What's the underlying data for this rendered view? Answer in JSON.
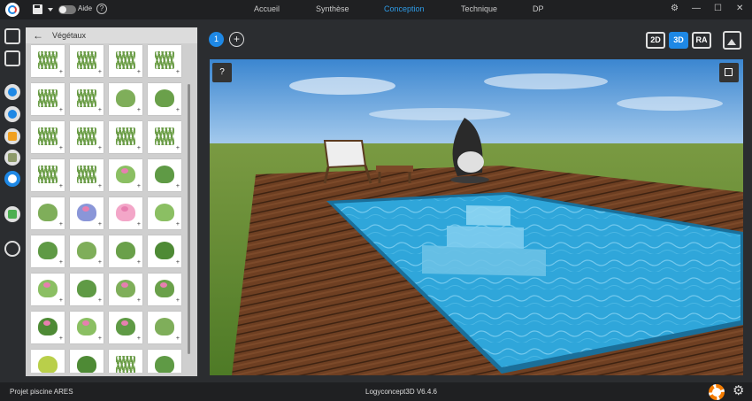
{
  "topbar": {
    "aide_label": "Aide",
    "help_label": "?",
    "tabs": [
      {
        "label": "Accueil",
        "active": false
      },
      {
        "label": "Synthèse",
        "active": false
      },
      {
        "label": "Conception",
        "active": true
      },
      {
        "label": "Technique",
        "active": false
      },
      {
        "label": "DP",
        "active": false
      }
    ],
    "window_buttons": {
      "settings": "⚙",
      "minimize": "—",
      "maximize": "☐",
      "close": "✕"
    }
  },
  "colors": {
    "accent": "#1e88e5",
    "active_tab": "#2e9be6",
    "topbar_bg": "#1f2022"
  },
  "panel": {
    "back_icon": "arrow-left-icon",
    "title": "Végétaux",
    "items": [
      {
        "icon": "ornamental-grass-red-icon"
      },
      {
        "icon": "ornamental-grass-icon"
      },
      {
        "icon": "ornamental-grass-icon"
      },
      {
        "icon": "ornamental-grass-icon"
      },
      {
        "icon": "grass-tuft-icon"
      },
      {
        "icon": "grass-tuft-icon"
      },
      {
        "icon": "small-shrub-icon"
      },
      {
        "icon": "fern-icon"
      },
      {
        "icon": "tall-grass-icon"
      },
      {
        "icon": "reed-grass-icon"
      },
      {
        "icon": "small-grass-icon"
      },
      {
        "icon": "grass-tuft-icon"
      },
      {
        "icon": "grass-clump-icon"
      },
      {
        "icon": "fountain-grass-icon"
      },
      {
        "icon": "pink-flower-icon"
      },
      {
        "icon": "shrub-icon"
      },
      {
        "icon": "planter-box-icon"
      },
      {
        "icon": "blue-flowers-icon"
      },
      {
        "icon": "lotus-icon"
      },
      {
        "icon": "leafy-shrub-icon"
      },
      {
        "icon": "leafy-shrub-icon"
      },
      {
        "icon": "leafy-shrub-icon"
      },
      {
        "icon": "leafy-shrub-icon"
      },
      {
        "icon": "leafy-shrub-icon"
      },
      {
        "icon": "lupin-icon"
      },
      {
        "icon": "palm-plant-icon"
      },
      {
        "icon": "flowering-bush-icon"
      },
      {
        "icon": "flowering-bush-icon"
      },
      {
        "icon": "rose-bush-icon"
      },
      {
        "icon": "rose-bush-icon"
      },
      {
        "icon": "pink-flower-bush-icon"
      },
      {
        "icon": "potted-plant-icon"
      },
      {
        "icon": "yellow-shrub-icon"
      },
      {
        "icon": "small-palm-icon"
      },
      {
        "icon": "grass-tuft-icon"
      },
      {
        "icon": "green-bush-icon"
      }
    ]
  },
  "view": {
    "level_label": "1",
    "add_level_label": "+",
    "modes": [
      {
        "label": "2D",
        "active": false
      },
      {
        "label": "3D",
        "active": true
      },
      {
        "label": "RA",
        "active": false
      }
    ],
    "help_label": "?"
  },
  "status": {
    "project": "Projet piscine ARES",
    "version": "Logyconcept3D V6.4.6"
  }
}
